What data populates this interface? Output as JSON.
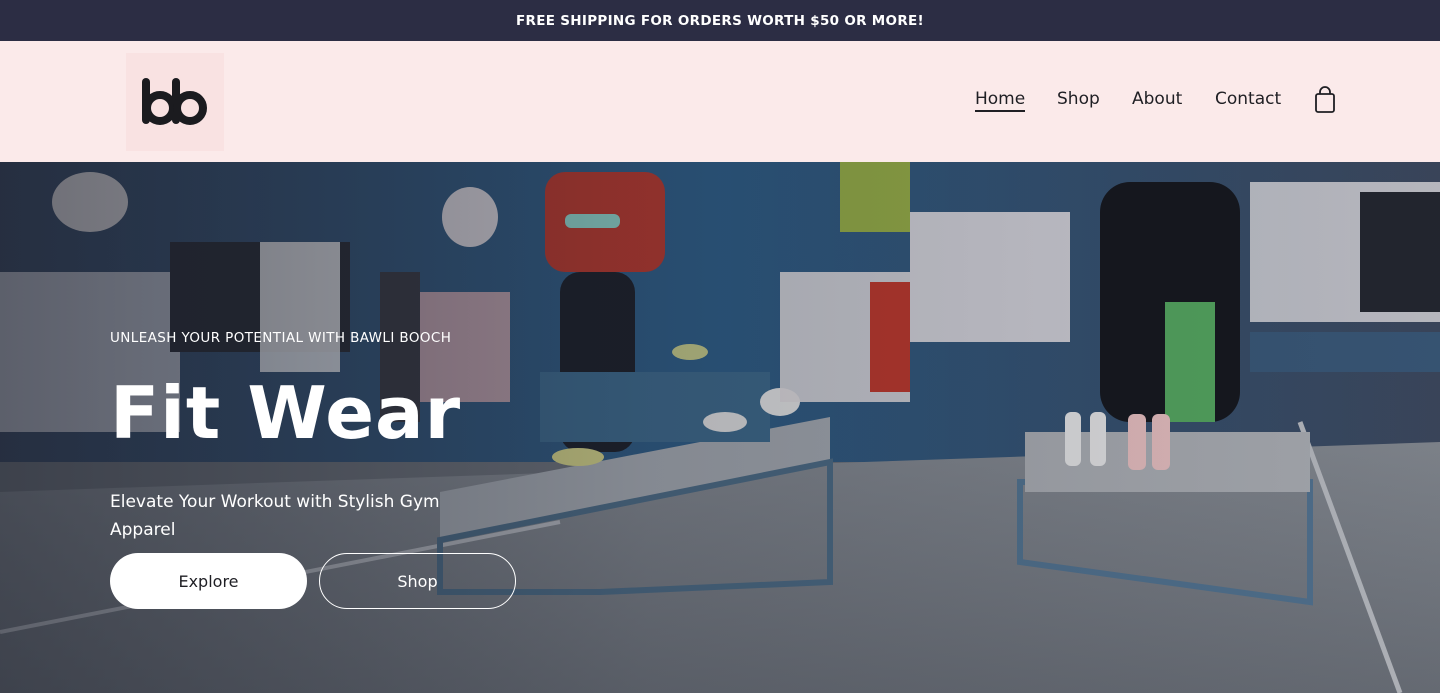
{
  "announcement": {
    "text": "FREE SHIPPING FOR ORDERS WORTH $50 OR MORE!"
  },
  "header": {
    "logo_alt": "bb",
    "nav": [
      {
        "label": "Home",
        "active": true
      },
      {
        "label": "Shop",
        "active": false
      },
      {
        "label": "About",
        "active": false
      },
      {
        "label": "Contact",
        "active": false
      }
    ],
    "cart_icon": "shopping-bag-icon"
  },
  "hero": {
    "eyebrow": "UNLEASH YOUR POTENTIAL WITH BAWLI BOOCH",
    "title": "Fit Wear",
    "subtitle": "Elevate Your Workout with Stylish Gym Apparel",
    "buttons": {
      "explore": "Explore",
      "shop": "Shop"
    },
    "background_image": "sportswear-store-interior"
  },
  "colors": {
    "announce_bg": "#2c2d44",
    "header_bg": "#fbeaea",
    "logo_bg": "#f9e2e2",
    "text_dark": "#1f1f24"
  }
}
